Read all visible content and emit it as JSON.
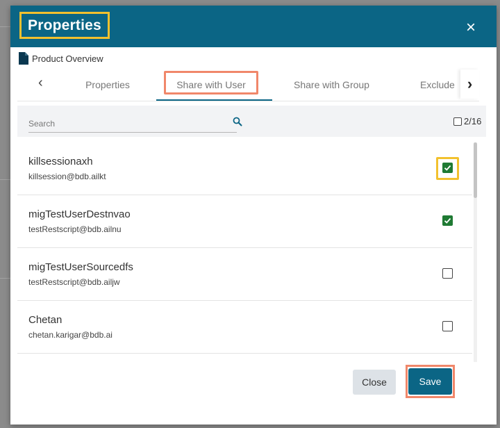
{
  "dialog": {
    "title": "Properties",
    "close_icon": "×",
    "document_name": "Product Overview"
  },
  "tabs": {
    "items": [
      {
        "label": "Properties"
      },
      {
        "label": "Share with User",
        "active": true
      },
      {
        "label": "Share with Group"
      },
      {
        "label": "Exclude"
      }
    ],
    "left_arrow": "‹",
    "right_arrow": "›"
  },
  "search": {
    "placeholder": "Search",
    "selected_count": "2/16"
  },
  "users": [
    {
      "name": "killsessionaxh",
      "email": "killsession@bdb.ailkt",
      "checked": true
    },
    {
      "name": "migTestUserDestnvao",
      "email": "testRestscript@bdb.ailnu",
      "checked": true
    },
    {
      "name": "migTestUserSourcedfs",
      "email": "testRestscript@bdb.ailjw",
      "checked": false
    },
    {
      "name": "Chetan",
      "email": "chetan.karigar@bdb.ai",
      "checked": false
    }
  ],
  "footer": {
    "close_label": "Close",
    "save_label": "Save"
  },
  "colors": {
    "header": "#0b6585",
    "highlight_yellow": "#f2c12e",
    "highlight_orange": "#f0876a",
    "checkbox_checked": "#1f7a33"
  }
}
